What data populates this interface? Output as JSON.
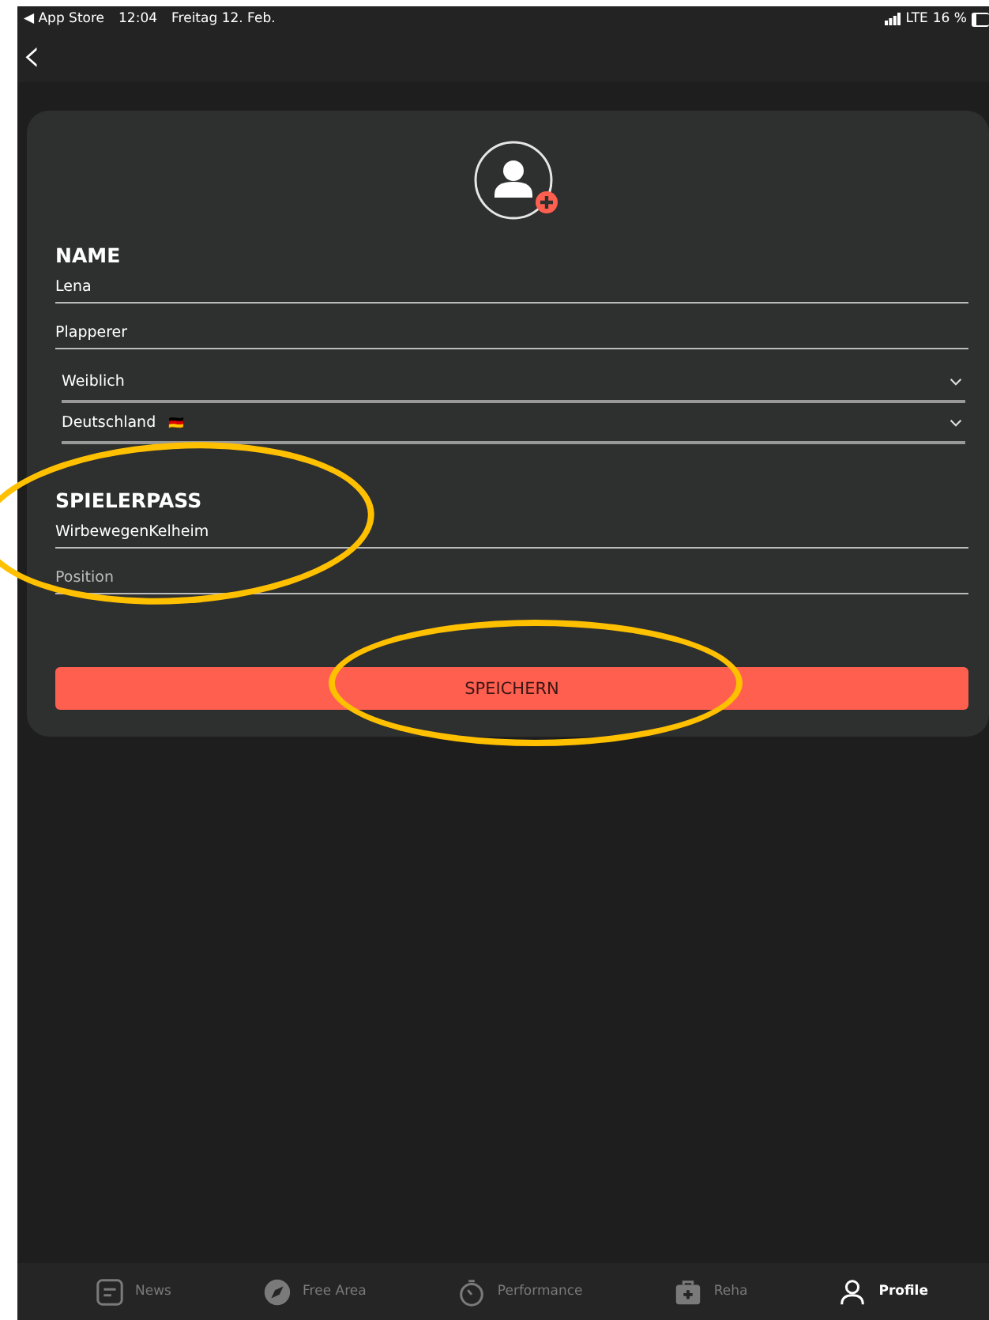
{
  "status_bar": {
    "back_app": "◀ App Store",
    "time": "12:04",
    "date": "Freitag 12. Feb.",
    "network": "LTE",
    "battery": "16 %"
  },
  "nav": {
    "back": "‹"
  },
  "form": {
    "sections": [
      {
        "title": "NAME",
        "fields": [
          {
            "kind": "text",
            "value": "Lena"
          },
          {
            "kind": "text",
            "value": "Plapperer"
          },
          {
            "kind": "select",
            "value": "Weiblich"
          },
          {
            "kind": "select",
            "value": "Deutschland",
            "flag": "🇩🇪"
          }
        ]
      },
      {
        "title": "SPIELERPASS",
        "fields": [
          {
            "kind": "text",
            "value": "WirbewegenKelheim"
          },
          {
            "kind": "text",
            "placeholder": "Position"
          }
        ]
      }
    ],
    "save_button": "SPEICHERN"
  },
  "annotations": [
    {
      "kind": "ellipse",
      "color": "#ffc000"
    },
    {
      "kind": "ellipse",
      "color": "#ffc000"
    }
  ],
  "tab_bar": [
    {
      "label": "News",
      "kind": "news",
      "selected": false
    },
    {
      "label": "Free Area",
      "kind": "compass",
      "selected": false
    },
    {
      "label": "Performance",
      "kind": "stopwatch",
      "selected": false
    },
    {
      "label": "Reha",
      "kind": "kit",
      "selected": false
    },
    {
      "label": "Profile",
      "kind": "person",
      "selected": true
    }
  ]
}
